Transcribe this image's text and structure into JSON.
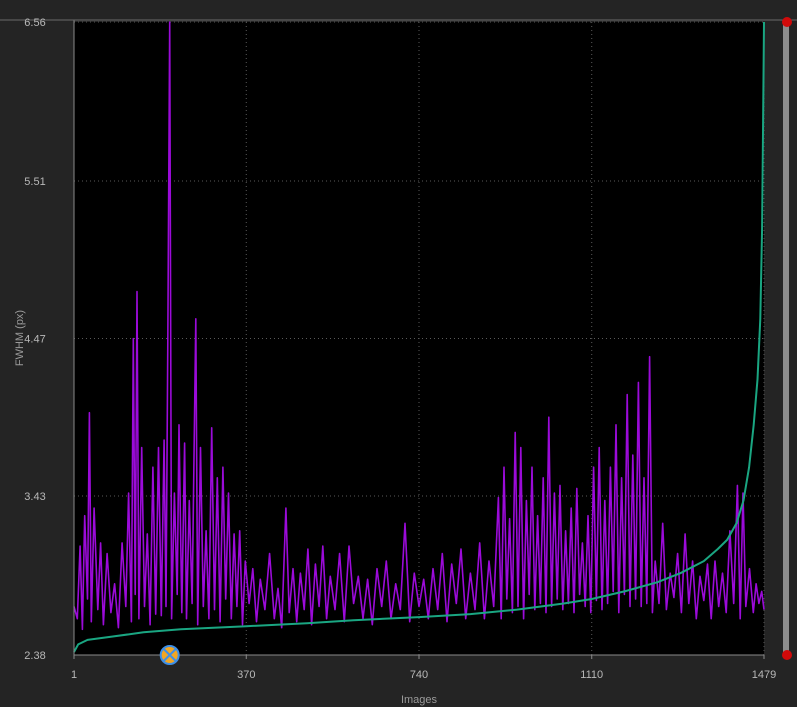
{
  "colors": {
    "background": "#242424",
    "plot_background": "#000000",
    "grid": "#5a5a5a",
    "measurement_series": "#9b0bd9",
    "sorted_series": "#1aa682",
    "marker_outline": "#3f8fe6",
    "marker_fill": "#f2a623",
    "handle": "#d10a0a",
    "range_bar": "#8c8c8c"
  },
  "chart_data": {
    "type": "line",
    "xlabel": "Images",
    "ylabel": "FWHM (px)",
    "xlim": [
      1,
      1479
    ],
    "ylim": [
      2.38,
      6.56
    ],
    "x_ticks": [
      "1",
      "370",
      "740",
      "1110",
      "1479"
    ],
    "y_ticks": [
      "2.38",
      "3.43",
      "4.47",
      "5.51",
      "6.56"
    ],
    "grid": true,
    "series": [
      {
        "style": "jagged-line",
        "color": "#9b0bd9",
        "approx_baseline": 2.67,
        "points": [
          [
            1,
            2.7
          ],
          [
            8,
            2.62
          ],
          [
            14,
            3.1
          ],
          [
            19,
            2.55
          ],
          [
            24,
            3.3
          ],
          [
            30,
            2.75
          ],
          [
            34,
            3.98
          ],
          [
            38,
            2.6
          ],
          [
            44,
            3.35
          ],
          [
            52,
            2.68
          ],
          [
            58,
            3.12
          ],
          [
            64,
            2.58
          ],
          [
            72,
            3.05
          ],
          [
            80,
            2.66
          ],
          [
            88,
            2.85
          ],
          [
            96,
            2.56
          ],
          [
            104,
            3.12
          ],
          [
            112,
            2.7
          ],
          [
            118,
            3.45
          ],
          [
            124,
            2.6
          ],
          [
            128,
            4.47
          ],
          [
            132,
            2.78
          ],
          [
            136,
            4.78
          ],
          [
            140,
            2.62
          ],
          [
            146,
            3.75
          ],
          [
            152,
            2.7
          ],
          [
            158,
            3.18
          ],
          [
            164,
            2.58
          ],
          [
            170,
            3.62
          ],
          [
            176,
            2.65
          ],
          [
            182,
            3.75
          ],
          [
            188,
            2.64
          ],
          [
            194,
            3.8
          ],
          [
            198,
            2.7
          ],
          [
            202,
            4.45
          ],
          [
            206,
            6.56
          ],
          [
            210,
            2.62
          ],
          [
            216,
            3.45
          ],
          [
            222,
            2.78
          ],
          [
            226,
            3.9
          ],
          [
            232,
            2.66
          ],
          [
            238,
            3.78
          ],
          [
            242,
            2.62
          ],
          [
            248,
            3.4
          ],
          [
            254,
            2.72
          ],
          [
            262,
            4.6
          ],
          [
            266,
            2.58
          ],
          [
            272,
            3.75
          ],
          [
            278,
            2.7
          ],
          [
            284,
            3.2
          ],
          [
            290,
            2.62
          ],
          [
            296,
            3.88
          ],
          [
            302,
            2.68
          ],
          [
            308,
            3.55
          ],
          [
            314,
            2.6
          ],
          [
            320,
            3.62
          ],
          [
            326,
            2.75
          ],
          [
            332,
            3.45
          ],
          [
            338,
            2.62
          ],
          [
            344,
            3.18
          ],
          [
            350,
            2.7
          ],
          [
            356,
            3.2
          ],
          [
            362,
            2.58
          ],
          [
            368,
            3.0
          ],
          [
            376,
            2.72
          ],
          [
            384,
            2.95
          ],
          [
            392,
            2.6
          ],
          [
            400,
            2.88
          ],
          [
            410,
            2.68
          ],
          [
            420,
            3.05
          ],
          [
            430,
            2.62
          ],
          [
            438,
            2.82
          ],
          [
            446,
            2.56
          ],
          [
            455,
            3.35
          ],
          [
            462,
            2.66
          ],
          [
            470,
            2.95
          ],
          [
            478,
            2.6
          ],
          [
            486,
            2.92
          ],
          [
            494,
            2.68
          ],
          [
            502,
            3.08
          ],
          [
            510,
            2.58
          ],
          [
            518,
            2.98
          ],
          [
            526,
            2.7
          ],
          [
            534,
            3.1
          ],
          [
            542,
            2.62
          ],
          [
            550,
            2.9
          ],
          [
            560,
            2.68
          ],
          [
            570,
            3.05
          ],
          [
            580,
            2.6
          ],
          [
            590,
            3.1
          ],
          [
            600,
            2.72
          ],
          [
            610,
            2.9
          ],
          [
            620,
            2.62
          ],
          [
            630,
            2.88
          ],
          [
            640,
            2.58
          ],
          [
            650,
            2.95
          ],
          [
            660,
            2.7
          ],
          [
            670,
            3.0
          ],
          [
            680,
            2.62
          ],
          [
            690,
            2.85
          ],
          [
            700,
            2.68
          ],
          [
            710,
            3.25
          ],
          [
            720,
            2.6
          ],
          [
            730,
            2.92
          ],
          [
            740,
            2.7
          ],
          [
            750,
            2.88
          ],
          [
            760,
            2.62
          ],
          [
            770,
            2.95
          ],
          [
            780,
            2.68
          ],
          [
            790,
            3.05
          ],
          [
            800,
            2.6
          ],
          [
            810,
            2.98
          ],
          [
            820,
            2.72
          ],
          [
            830,
            3.08
          ],
          [
            840,
            2.62
          ],
          [
            850,
            2.92
          ],
          [
            860,
            2.68
          ],
          [
            870,
            3.12
          ],
          [
            880,
            2.62
          ],
          [
            890,
            3.0
          ],
          [
            900,
            2.7
          ],
          [
            910,
            3.42
          ],
          [
            916,
            2.62
          ],
          [
            922,
            3.62
          ],
          [
            928,
            2.75
          ],
          [
            934,
            3.28
          ],
          [
            940,
            2.66
          ],
          [
            946,
            3.85
          ],
          [
            952,
            2.7
          ],
          [
            958,
            3.75
          ],
          [
            964,
            2.62
          ],
          [
            970,
            3.4
          ],
          [
            976,
            2.78
          ],
          [
            982,
            3.62
          ],
          [
            988,
            2.68
          ],
          [
            994,
            3.3
          ],
          [
            1000,
            2.72
          ],
          [
            1006,
            3.55
          ],
          [
            1012,
            2.66
          ],
          [
            1018,
            3.95
          ],
          [
            1024,
            2.7
          ],
          [
            1030,
            3.45
          ],
          [
            1036,
            2.75
          ],
          [
            1042,
            3.5
          ],
          [
            1048,
            2.68
          ],
          [
            1054,
            3.2
          ],
          [
            1060,
            2.72
          ],
          [
            1066,
            3.35
          ],
          [
            1072,
            2.66
          ],
          [
            1078,
            3.48
          ],
          [
            1084,
            2.78
          ],
          [
            1090,
            3.12
          ],
          [
            1096,
            2.7
          ],
          [
            1102,
            3.3
          ],
          [
            1108,
            2.66
          ],
          [
            1114,
            3.62
          ],
          [
            1120,
            2.74
          ],
          [
            1126,
            3.75
          ],
          [
            1132,
            2.68
          ],
          [
            1138,
            3.4
          ],
          [
            1144,
            2.72
          ],
          [
            1150,
            3.62
          ],
          [
            1156,
            2.8
          ],
          [
            1162,
            3.9
          ],
          [
            1168,
            2.66
          ],
          [
            1174,
            3.55
          ],
          [
            1180,
            2.78
          ],
          [
            1186,
            4.1
          ],
          [
            1192,
            2.7
          ],
          [
            1198,
            3.7
          ],
          [
            1204,
            2.75
          ],
          [
            1210,
            4.18
          ],
          [
            1216,
            2.7
          ],
          [
            1222,
            3.55
          ],
          [
            1228,
            2.72
          ],
          [
            1234,
            4.35
          ],
          [
            1240,
            2.66
          ],
          [
            1246,
            3.0
          ],
          [
            1254,
            2.72
          ],
          [
            1262,
            3.25
          ],
          [
            1270,
            2.68
          ],
          [
            1278,
            2.92
          ],
          [
            1286,
            2.76
          ],
          [
            1294,
            3.05
          ],
          [
            1302,
            2.66
          ],
          [
            1310,
            3.18
          ],
          [
            1318,
            2.72
          ],
          [
            1326,
            3.0
          ],
          [
            1334,
            2.62
          ],
          [
            1342,
            2.9
          ],
          [
            1350,
            2.74
          ],
          [
            1358,
            2.98
          ],
          [
            1366,
            2.62
          ],
          [
            1374,
            3.0
          ],
          [
            1382,
            2.7
          ],
          [
            1390,
            2.92
          ],
          [
            1398,
            2.66
          ],
          [
            1406,
            3.2
          ],
          [
            1414,
            2.72
          ],
          [
            1422,
            3.5
          ],
          [
            1428,
            2.62
          ],
          [
            1434,
            3.45
          ],
          [
            1440,
            2.7
          ],
          [
            1448,
            2.95
          ],
          [
            1456,
            2.66
          ],
          [
            1462,
            2.85
          ],
          [
            1468,
            2.72
          ],
          [
            1474,
            2.8
          ],
          [
            1479,
            2.68
          ]
        ]
      },
      {
        "style": "smooth-line",
        "color": "#1aa682",
        "points": [
          [
            1,
            2.4
          ],
          [
            10,
            2.45
          ],
          [
            30,
            2.48
          ],
          [
            80,
            2.5
          ],
          [
            150,
            2.53
          ],
          [
            230,
            2.55
          ],
          [
            370,
            2.57
          ],
          [
            500,
            2.59
          ],
          [
            600,
            2.61
          ],
          [
            740,
            2.63
          ],
          [
            850,
            2.65
          ],
          [
            950,
            2.68
          ],
          [
            1050,
            2.72
          ],
          [
            1110,
            2.75
          ],
          [
            1180,
            2.8
          ],
          [
            1250,
            2.86
          ],
          [
            1300,
            2.92
          ],
          [
            1350,
            3.0
          ],
          [
            1380,
            3.08
          ],
          [
            1400,
            3.14
          ],
          [
            1420,
            3.25
          ],
          [
            1435,
            3.4
          ],
          [
            1447,
            3.62
          ],
          [
            1457,
            3.9
          ],
          [
            1465,
            4.2
          ],
          [
            1471,
            4.6
          ],
          [
            1475,
            5.2
          ],
          [
            1477,
            5.9
          ],
          [
            1479,
            6.56
          ]
        ]
      }
    ],
    "marker": {
      "x": 206,
      "y": 2.38
    }
  }
}
